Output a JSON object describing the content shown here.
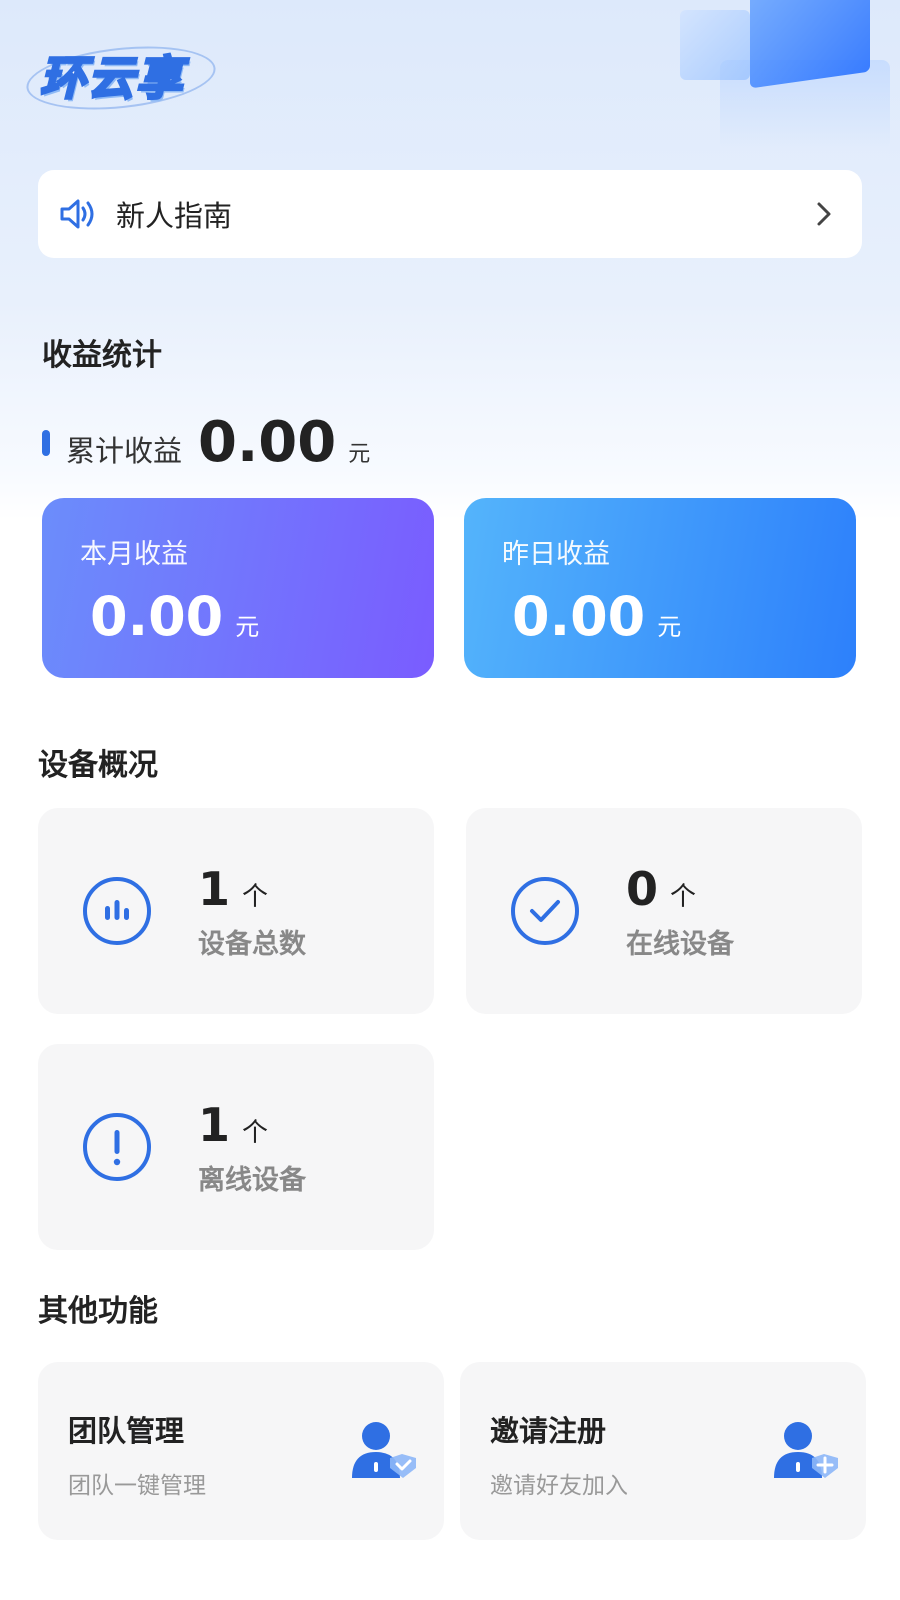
{
  "brand": {
    "logo_text": "环云享"
  },
  "guide": {
    "label": "新人指南",
    "icon": "speaker-icon",
    "arrow_icon": "chevron-right-icon"
  },
  "earnings": {
    "section_title": "收益统计",
    "total_label": "累计收益",
    "total_value": "0.00",
    "total_unit": "元",
    "month": {
      "label": "本月收益",
      "value": "0.00",
      "unit": "元"
    },
    "yesterday": {
      "label": "昨日收益",
      "value": "0.00",
      "unit": "元"
    }
  },
  "devices": {
    "section_title": "设备概况",
    "items": [
      {
        "icon": "bar-chart-icon",
        "count": "1",
        "unit": "个",
        "label": "设备总数"
      },
      {
        "icon": "check-circle-icon",
        "count": "0",
        "unit": "个",
        "label": "在线设备"
      },
      {
        "icon": "alert-circle-icon",
        "count": "1",
        "unit": "个",
        "label": "离线设备"
      }
    ]
  },
  "functions": {
    "section_title": "其他功能",
    "items": [
      {
        "title": "团队管理",
        "subtitle": "团队一键管理",
        "icon": "team-manage-icon"
      },
      {
        "title": "邀请注册",
        "subtitle": "邀请好友加入",
        "icon": "invite-user-icon"
      }
    ]
  },
  "colors": {
    "accent": "#2f6fe3",
    "month_card": "#7a5cff",
    "yesterday_card": "#2d80fb",
    "card_bg": "#f6f6f7"
  }
}
